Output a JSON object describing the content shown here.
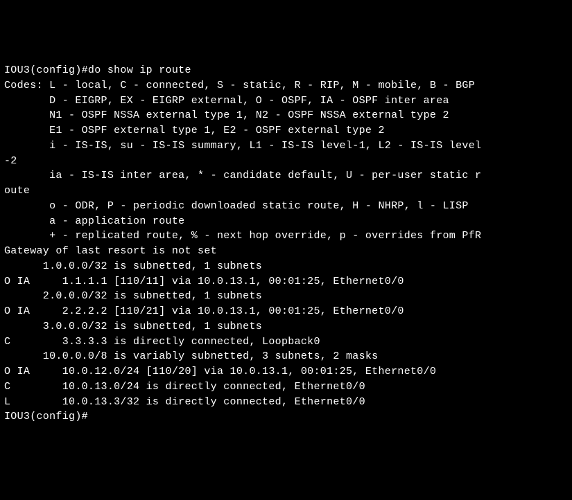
{
  "terminal": {
    "lines": [
      "IOU3(config)#do show ip route",
      "Codes: L - local, C - connected, S - static, R - RIP, M - mobile, B - BGP",
      "       D - EIGRP, EX - EIGRP external, O - OSPF, IA - OSPF inter area",
      "       N1 - OSPF NSSA external type 1, N2 - OSPF NSSA external type 2",
      "       E1 - OSPF external type 1, E2 - OSPF external type 2",
      "       i - IS-IS, su - IS-IS summary, L1 - IS-IS level-1, L2 - IS-IS level",
      "-2",
      "       ia - IS-IS inter area, * - candidate default, U - per-user static r",
      "oute",
      "       o - ODR, P - periodic downloaded static route, H - NHRP, l - LISP",
      "       a - application route",
      "       + - replicated route, % - next hop override, p - overrides from PfR",
      "",
      "Gateway of last resort is not set",
      "",
      "      1.0.0.0/32 is subnetted, 1 subnets",
      "O IA     1.1.1.1 [110/11] via 10.0.13.1, 00:01:25, Ethernet0/0",
      "      2.0.0.0/32 is subnetted, 1 subnets",
      "O IA     2.2.2.2 [110/21] via 10.0.13.1, 00:01:25, Ethernet0/0",
      "      3.0.0.0/32 is subnetted, 1 subnets",
      "C        3.3.3.3 is directly connected, Loopback0",
      "      10.0.0.0/8 is variably subnetted, 3 subnets, 2 masks",
      "O IA     10.0.12.0/24 [110/20] via 10.0.13.1, 00:01:25, Ethernet0/0",
      "C        10.0.13.0/24 is directly connected, Ethernet0/0",
      "L        10.0.13.3/32 is directly connected, Ethernet0/0",
      "IOU3(config)#"
    ]
  }
}
